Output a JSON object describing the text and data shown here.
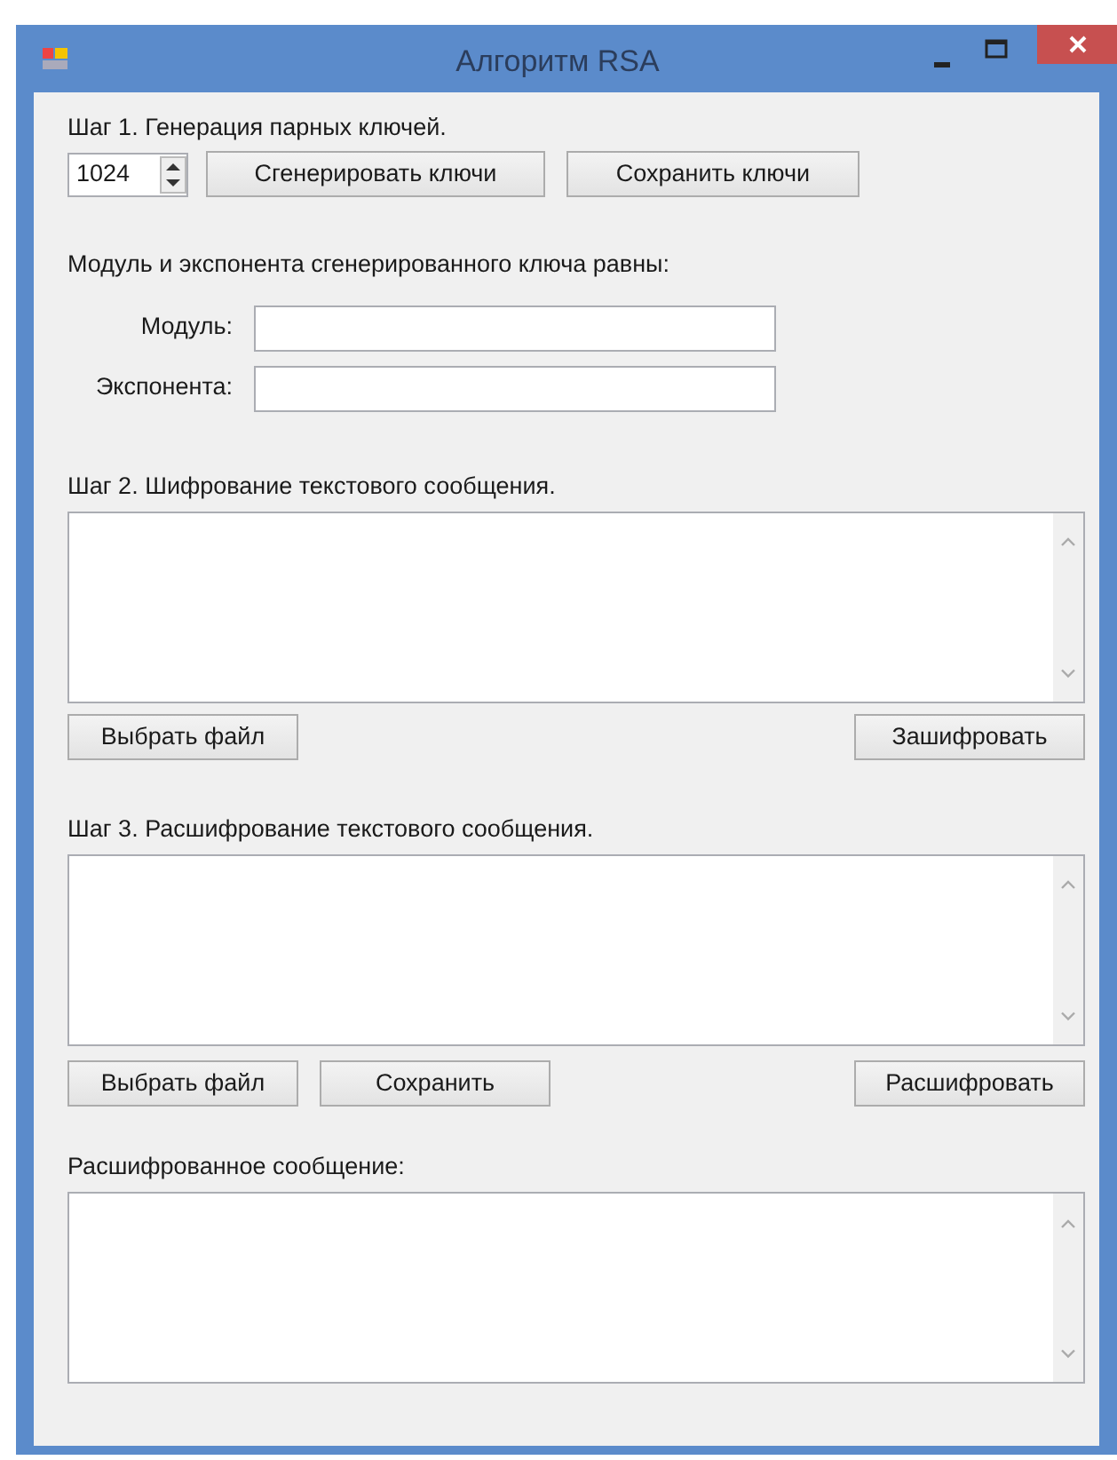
{
  "window": {
    "title": "Алгоритм RSA"
  },
  "step1": {
    "label": "Шаг 1. Генерация парных ключей.",
    "key_size": "1024",
    "buttons": [
      "Сгенерировать ключи",
      "Сохранить ключи"
    ]
  },
  "key_info": {
    "heading": "Модуль и экспонента сгенерированного ключа равны:",
    "fields": [
      {
        "label": "Модуль:"
      },
      {
        "label": "Экспонента:"
      }
    ]
  },
  "step2": {
    "label": "Шаг 2. Шифрование текстового сообщения.",
    "buttons": [
      "Выбрать файл",
      "Зашифровать"
    ]
  },
  "step3": {
    "label": "Шаг 3. Расшифрование текстового сообщения.",
    "buttons": [
      "Выбрать файл",
      "Сохранить",
      "Расшифровать"
    ]
  },
  "output": {
    "label": "Расшифрованное сообщение:"
  }
}
